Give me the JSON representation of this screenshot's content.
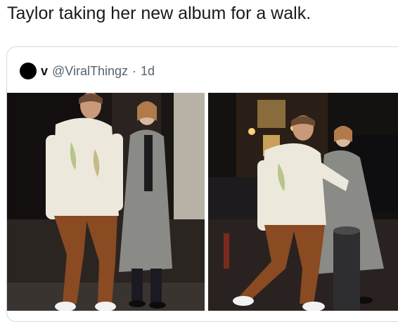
{
  "caption": "Taylor taking her new album for a walk.",
  "quote": {
    "display_name": "v",
    "handle": "@ViralThingz",
    "separator": "·",
    "time": "1d"
  },
  "photos": [
    {
      "name": "photo-left"
    },
    {
      "name": "photo-right"
    }
  ],
  "colors": {
    "border": "#cfd9de",
    "muted_text": "#536471",
    "jacket": "#ece8dc",
    "pants": "#8a4a22",
    "coat": "#8a8a86"
  }
}
